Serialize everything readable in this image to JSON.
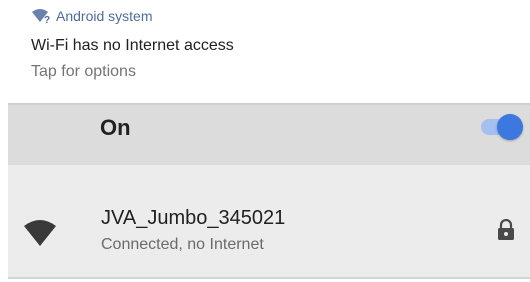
{
  "notification": {
    "app_icon": "wifi-question-icon",
    "app_name": "Android system",
    "title": "Wi-Fi has no Internet access",
    "text": "Tap for options"
  },
  "wifi_master": {
    "label": "On",
    "state": "on",
    "accent_color": "#3c78e0"
  },
  "networks": [
    {
      "ssid": "JVA_Jumbo_345021",
      "status": "Connected, no Internet",
      "signal_icon": "wifi-signal-icon",
      "secured_icon": "lock-icon"
    }
  ]
}
